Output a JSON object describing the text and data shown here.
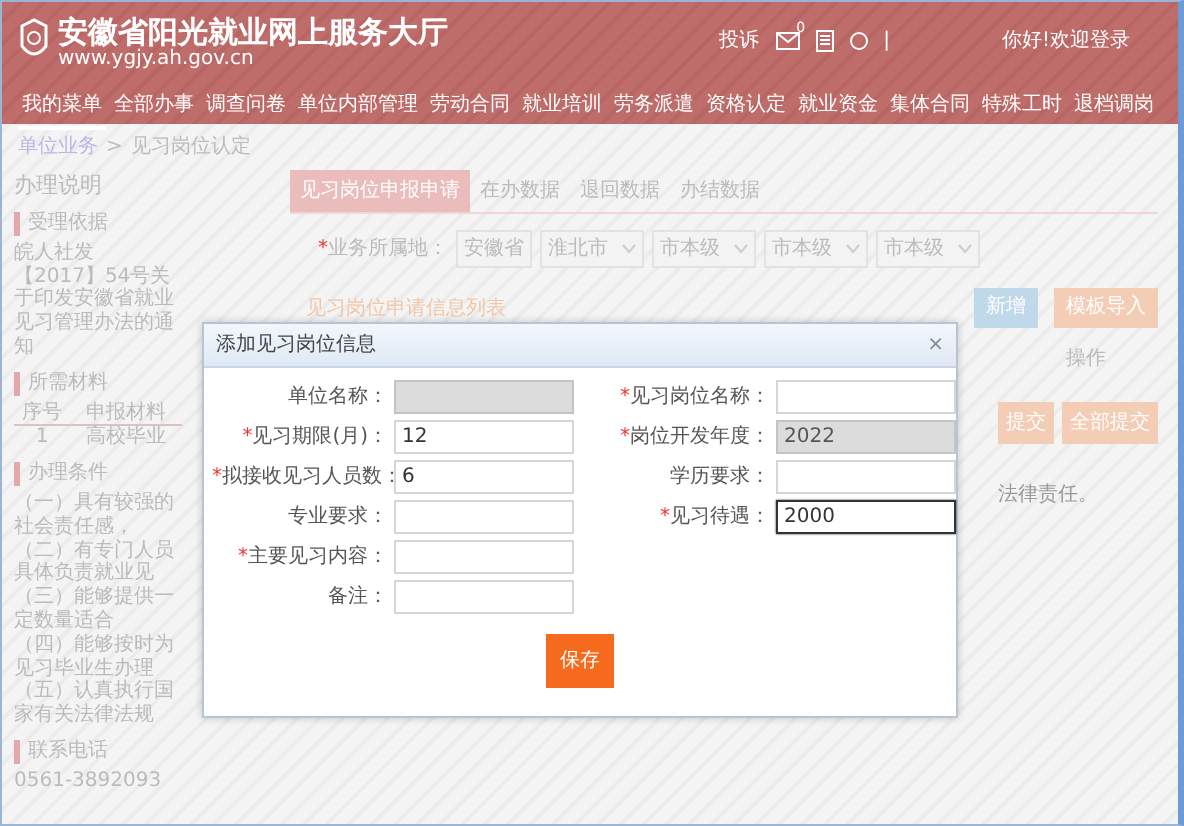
{
  "header": {
    "title": "安徽省阳光就业网上服务大厅",
    "url": "www.ygjy.ah.gov.cn",
    "link": "投诉",
    "mail_count": "0",
    "separator": "|",
    "greeting": "你好!欢迎登录"
  },
  "nav": [
    {
      "label": "我的菜单",
      "selected": true
    },
    {
      "label": "全部办事",
      "selected": false
    },
    {
      "label": "调查问卷",
      "selected": false
    },
    {
      "label": "单位内部管理",
      "selected": false
    },
    {
      "label": "劳动合同",
      "selected": false
    },
    {
      "label": "就业培训",
      "selected": false
    },
    {
      "label": "劳务派遣",
      "selected": false
    },
    {
      "label": "资格认定",
      "selected": false
    },
    {
      "label": "就业资金",
      "selected": false
    },
    {
      "label": "集体合同",
      "selected": false
    },
    {
      "label": "特殊工时",
      "selected": false
    },
    {
      "label": "退档调岗",
      "selected": false
    }
  ],
  "breadcrumb": {
    "items": [
      "单位业务",
      "见习岗位认定"
    ],
    "separator": ">"
  },
  "sidebar": {
    "title": "办理说明",
    "sections": [
      {
        "heading": "受理依据",
        "kind": "text",
        "text": "皖人社发【2017】54号关于印发安徽省就业见习管理办法的通知"
      },
      {
        "heading": "所需材料",
        "kind": "table",
        "columns": [
          "序号",
          "申报材料"
        ],
        "rows": [
          [
            "1",
            "高校毕业"
          ]
        ]
      },
      {
        "heading": "办理条件",
        "kind": "list",
        "items": [
          "（一）具有较强的社会责任感，",
          "（二）有专门人员具体负责就业见",
          "（三）能够提供一定数量适合",
          "（四）能够按时为见习毕业生办理",
          "（五）认真执行国家有关法律法规"
        ]
      },
      {
        "heading": "联系电话",
        "kind": "text",
        "text": "0561-3892093"
      }
    ]
  },
  "tabs": [
    {
      "label": "见习岗位申报申请",
      "selected": true
    },
    {
      "label": "在办数据",
      "selected": false
    },
    {
      "label": "退回数据",
      "selected": false
    },
    {
      "label": "办结数据",
      "selected": false
    }
  ],
  "filter": {
    "mark": "*",
    "label": "业务所属地：",
    "province": "安徽省",
    "selects": [
      "淮北市",
      "市本级",
      "市本级",
      "市本级"
    ]
  },
  "list": {
    "title": "见习岗位申请信息列表",
    "buttons": [
      {
        "label": "新增",
        "kind": "add"
      },
      {
        "label": "模板导入",
        "kind": "import"
      }
    ]
  },
  "table": {
    "columns": [
      "操作"
    ],
    "row_buttons": [
      "提交",
      "全部提交"
    ],
    "note": "法律责任。"
  },
  "modal": {
    "title": "添加见习岗位信息",
    "close": "×",
    "save": "保存",
    "rows": [
      [
        {
          "label": "单位名称：",
          "disabled": true,
          "focused": false
        },
        {
          "mark": "*",
          "label": "见习岗位名称：",
          "disabled": false,
          "focused": false
        }
      ],
      [
        {
          "mark": "*",
          "label": "见习期限(月)：",
          "value": "12",
          "disabled": false,
          "focused": false
        },
        {
          "mark": "*",
          "label": "岗位开发年度：",
          "value": "2022",
          "disabled": true,
          "focused": false
        }
      ],
      [
        {
          "mark": "*",
          "label": "拟接收见习人员数：",
          "value": "6",
          "disabled": false,
          "focused": false
        },
        {
          "label": "学历要求：",
          "disabled": false,
          "focused": false
        }
      ],
      [
        {
          "label": "专业要求：",
          "disabled": false,
          "focused": false
        },
        {
          "mark": "*",
          "label": "见习待遇：",
          "value": "2000",
          "disabled": false,
          "focused": true
        }
      ],
      [
        {
          "mark": "*",
          "label": "主要见习内容：",
          "disabled": false,
          "focused": false
        }
      ],
      [
        {
          "label": "备注：",
          "disabled": false,
          "focused": false
        }
      ]
    ]
  }
}
